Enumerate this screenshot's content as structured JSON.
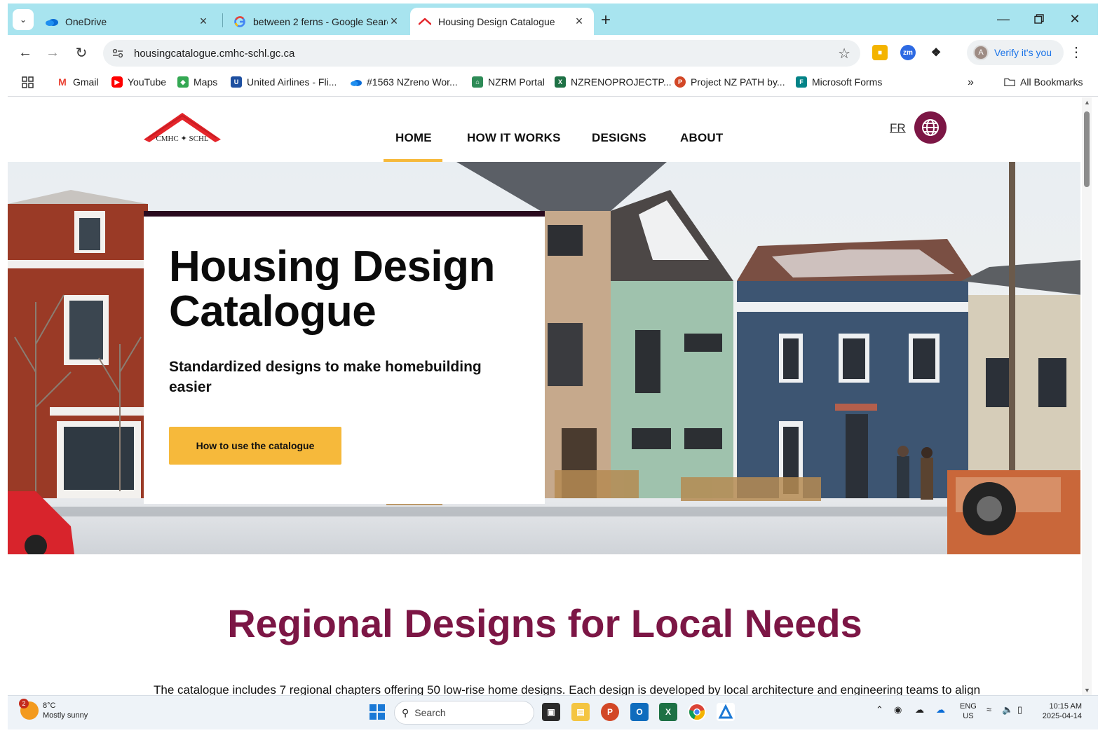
{
  "browser": {
    "tabs": [
      {
        "title": "OneDrive",
        "icon": "onedrive-icon",
        "active": false
      },
      {
        "title": "between 2 ferns - Google Searc",
        "icon": "google-icon",
        "active": false
      },
      {
        "title": "Housing Design Catalogue",
        "icon": "cmhc-roof-icon",
        "active": true
      }
    ],
    "url": "housingcatalogue.cmhc-schl.gc.ca",
    "profile_label": "Verify it's you",
    "profile_initial": "A",
    "bookmarks": [
      {
        "label": "Gmail",
        "icon": "gmail-icon",
        "color": "#ea4335"
      },
      {
        "label": "YouTube",
        "icon": "youtube-icon",
        "color": "#ff0000"
      },
      {
        "label": "Maps",
        "icon": "maps-icon",
        "color": "#34a853"
      },
      {
        "label": "United Airlines - Fli...",
        "icon": "united-icon",
        "color": "#1d4fa0"
      },
      {
        "label": "#1563 NZreno Wor...",
        "icon": "onedrive-icon",
        "color": "#0a84d6"
      },
      {
        "label": "NZRM Portal",
        "icon": "nzrm-icon",
        "color": "#2e8b57"
      },
      {
        "label": "NZRENOPROJECTP...",
        "icon": "excel-icon",
        "color": "#1e7145"
      },
      {
        "label": "Project NZ PATH by...",
        "icon": "powerpoint-icon",
        "color": "#d24726"
      },
      {
        "label": "Microsoft Forms",
        "icon": "forms-icon",
        "color": "#038387"
      }
    ],
    "all_bookmarks_label": "All Bookmarks"
  },
  "site": {
    "logo_text": "CMHC ✦ SCHL",
    "nav": [
      "HOME",
      "HOW IT WORKS",
      "DESIGNS",
      "ABOUT"
    ],
    "lang_toggle": "FR",
    "accent": "#7c1645",
    "button_color": "#f6b93b"
  },
  "hero": {
    "title": "Housing Design Catalogue",
    "subtitle": "Standardized designs to make homebuilding easier",
    "button": "How to use the catalogue"
  },
  "regional": {
    "title": "Regional Designs for Local Needs",
    "body": "The catalogue includes 7 regional chapters offering 50 low-rise home designs. Each design is developed by local architecture and engineering teams to align"
  },
  "taskbar": {
    "weather_temp": "8°C",
    "weather_desc": "Mostly sunny",
    "weather_badge": "2",
    "search_placeholder": "Search",
    "lang_line1": "ENG",
    "lang_line2": "US",
    "time": "10:15 AM",
    "date": "2025-04-14"
  }
}
